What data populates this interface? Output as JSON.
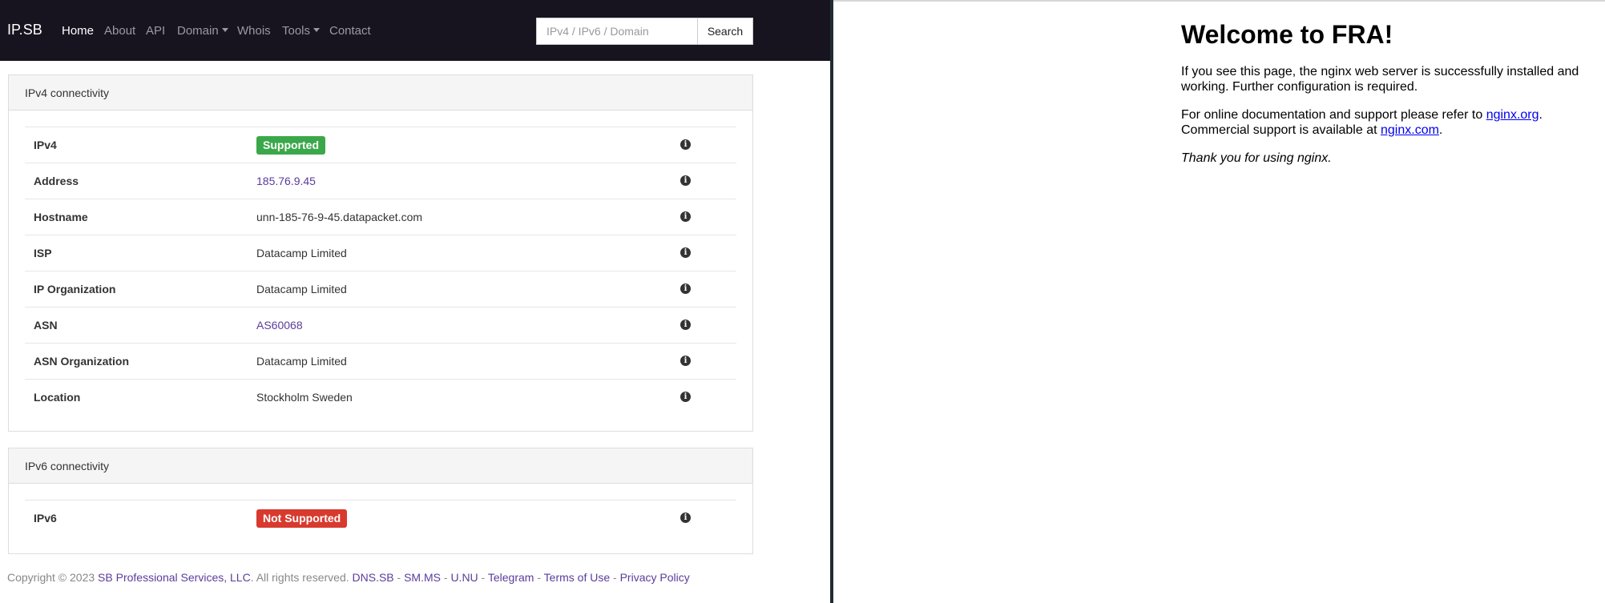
{
  "navbar": {
    "brand": "IP.SB",
    "items": [
      {
        "label": "Home"
      },
      {
        "label": "About"
      },
      {
        "label": "API"
      },
      {
        "label": "Domain"
      },
      {
        "label": "Whois"
      },
      {
        "label": "Tools"
      },
      {
        "label": "Contact"
      }
    ],
    "search": {
      "placeholder": "IPv4 / IPv6 / Domain",
      "value": "",
      "button": "Search"
    }
  },
  "ipv4": {
    "heading": "IPv4 connectivity",
    "rows": [
      {
        "label": "IPv4",
        "value": "Supported"
      },
      {
        "label": "Address",
        "value": "185.76.9.45"
      },
      {
        "label": "Hostname",
        "value": "unn-185-76-9-45.datapacket.com"
      },
      {
        "label": "ISP",
        "value": "Datacamp Limited"
      },
      {
        "label": "IP Organization",
        "value": "Datacamp Limited"
      },
      {
        "label": "ASN",
        "value": "AS60068"
      },
      {
        "label": "ASN Organization",
        "value": "Datacamp Limited"
      },
      {
        "label": "Location",
        "value": "Stockholm Sweden"
      }
    ]
  },
  "ipv6": {
    "heading": "IPv6 connectivity",
    "rows": [
      {
        "label": "IPv6",
        "value": "Not Supported"
      }
    ]
  },
  "footer": {
    "copyright": "Copyright © 2023 ",
    "company": "SB Professional Services, LLC",
    "rights": ". All rights reserved. ",
    "links": [
      "DNS.SB",
      "SM.MS",
      "U.NU",
      "Telegram",
      "Terms of Use",
      "Privacy Policy"
    ],
    "separator": " - "
  },
  "colors": {
    "navbar_bg": "#17141f",
    "supported_badge": "#3aa84a",
    "not_supported_badge": "#d83a2e",
    "link": "#5b3c9b"
  },
  "icons": [
    "info-icon"
  ],
  "nginx": {
    "title": "Welcome to FRA!",
    "p1": "If you see this page, the nginx web server is successfully installed and working. Further configuration is required.",
    "p2_pre": "For online documentation and support please refer to ",
    "p2_link": "nginx.org",
    "p2_mid": ".",
    "p2_line2": "Commercial support is available at ",
    "p2_link2": "nginx.com",
    "p2_end": ".",
    "p3": "Thank you for using nginx."
  }
}
